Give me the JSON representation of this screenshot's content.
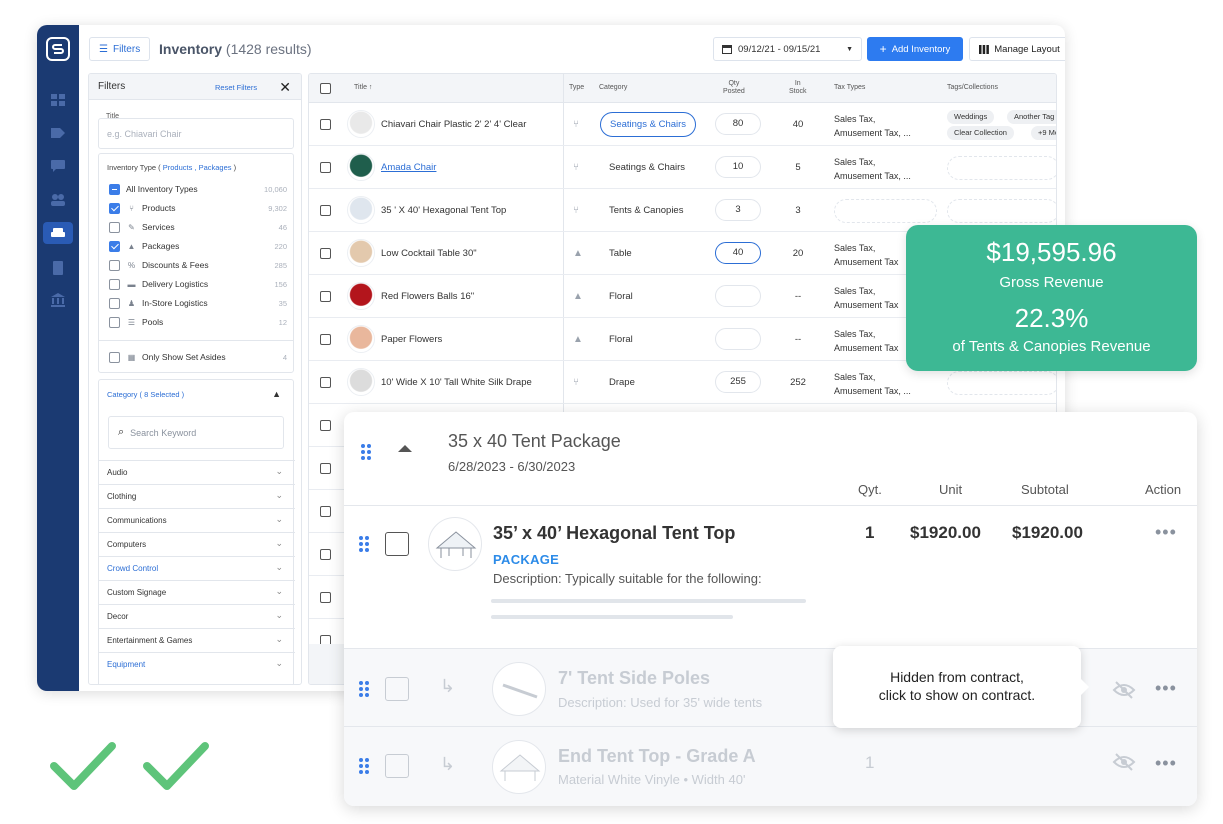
{
  "toolbar": {
    "filters_label": "Filters",
    "title": "Inventory",
    "results": "(1428 results)",
    "date_range": "09/12/21  -  09/15/21",
    "add_label": "Add Inventory",
    "layout_label": "Manage Layout"
  },
  "filters": {
    "heading": "Filters",
    "reset": "Reset Filters",
    "title_label": "Title",
    "title_placeholder": "e.g. Chiavari Chair",
    "type_label": "Inventory Type (",
    "type_selected": "Products , Packages",
    "type_close": ")",
    "types": [
      {
        "label": "All Inventory Types",
        "count": "10,060",
        "state": "ind",
        "icon": ""
      },
      {
        "label": "Products",
        "count": "9,302",
        "state": "on",
        "icon": "chair-icon"
      },
      {
        "label": "Services",
        "count": "46",
        "state": "off",
        "icon": "wrench-icon"
      },
      {
        "label": "Packages",
        "count": "220",
        "state": "on",
        "icon": "boxes-icon"
      },
      {
        "label": "Discounts & Fees",
        "count": "285",
        "state": "off",
        "icon": "tag-icon"
      },
      {
        "label": "Delivery Logistics",
        "count": "156",
        "state": "off",
        "icon": "truck-icon"
      },
      {
        "label": "In-Store Logistics",
        "count": "35",
        "state": "off",
        "icon": "person-icon"
      },
      {
        "label": "Pools",
        "count": "12",
        "state": "off",
        "icon": "list-icon"
      }
    ],
    "set_asides": {
      "label": "Only Show Set Asides",
      "count": "4"
    },
    "category_label": "Category (",
    "category_selected": "8 Selected",
    "category_close": ")",
    "keyword_placeholder": "Search Keyword",
    "categories": [
      {
        "label": "Audio",
        "blue": false
      },
      {
        "label": "Clothing",
        "blue": false
      },
      {
        "label": "Communications",
        "blue": false
      },
      {
        "label": "Computers",
        "blue": false
      },
      {
        "label": "Crowd Control",
        "blue": true
      },
      {
        "label": "Custom Signage",
        "blue": false
      },
      {
        "label": "Decor",
        "blue": false
      },
      {
        "label": "Entertainment & Games",
        "blue": false
      },
      {
        "label": "Equipment",
        "blue": true
      }
    ]
  },
  "table": {
    "headers": {
      "title": "Title ↑",
      "type": "Type",
      "category": "Category",
      "qty": [
        "Qty",
        "Posted"
      ],
      "stock": [
        "In",
        "Stock"
      ],
      "tax": "Tax Types",
      "tags": "Tags/Collections"
    },
    "rows": [
      {
        "title": "Chiavari Chair Plastic 2' 2' 4' Clear",
        "category": "Seatings & Chairs",
        "pill": true,
        "qty": "80",
        "hl": false,
        "stock": "40",
        "tax": [
          "Sales Tax,",
          "Amusement Tax, ..."
        ],
        "tags": [
          "Weddings",
          "Another Tag",
          "Clear Collection",
          "+9 More"
        ],
        "thumb": "#e9e9e9",
        "link": false
      },
      {
        "title": "Amada Chair",
        "category": "Seatings & Chairs",
        "pill": false,
        "qty": "10",
        "hl": false,
        "stock": "5",
        "tax": [
          "Sales Tax,",
          "Amusement Tax, ..."
        ],
        "tags": [],
        "thumb": "#1f5e4c",
        "link": true
      },
      {
        "title": "35 ' X 40' Hexagonal Tent Top",
        "category": "Tents & Canopies",
        "pill": false,
        "qty": "3",
        "hl": false,
        "stock": "3",
        "tax": [],
        "tags": [],
        "thumb": "#dfe6ee",
        "link": false
      },
      {
        "title": "Low Cocktail Table 30\"",
        "category": "Table",
        "pill": false,
        "qty": "40",
        "hl": true,
        "stock": "20",
        "tax": [
          "Sales Tax,",
          "Amusement Tax"
        ],
        "tags": [],
        "thumb": "#e3c9ad",
        "link": false
      },
      {
        "title": "Red Flowers Balls 16\"",
        "category": "Floral",
        "pill": false,
        "qty": "",
        "hl": false,
        "stock": "--",
        "tax": [
          "Sales Tax,",
          "Amusement Tax"
        ],
        "tags": [],
        "thumb": "#b3151c",
        "link": false
      },
      {
        "title": "Paper Flowers",
        "category": "Floral",
        "pill": false,
        "qty": "",
        "hl": false,
        "stock": "--",
        "tax": [
          "Sales Tax,",
          "Amusement Tax"
        ],
        "tags": [],
        "thumb": "#e9b79c",
        "link": false
      },
      {
        "title": "10' Wide X 10' Tall White Silk Drape",
        "category": "Drape",
        "pill": false,
        "qty": "255",
        "hl": false,
        "stock": "252",
        "tax": [
          "Sales Tax,",
          "Amusement Tax, ..."
        ],
        "tags": [],
        "thumb": "#dcdcdc",
        "link": false
      }
    ]
  },
  "revenue": {
    "gross_value": "$19,595.96",
    "gross_label": "Gross Revenue",
    "pct_value": "22.3%",
    "pct_label": "of Tents & Canopies Revenue"
  },
  "package": {
    "title": "35 x 40 Tent Package",
    "dates": "6/28/2023 - 6/30/2023",
    "col_qty": "Qyt.",
    "col_unit": "Unit",
    "col_subtotal": "Subtotal",
    "col_action": "Action",
    "item": {
      "title": "35’ x 40’ Hexagonal Tent Top",
      "kind": "PACKAGE",
      "desc": "Description: Typically suitable for the following:",
      "qty": "1",
      "unit": "$1920.00",
      "subtotal": "$1920.00"
    },
    "sub1": {
      "title": "7' Tent Side Poles",
      "desc": "Description: Used for 35' wide tents"
    },
    "sub2": {
      "title": "End Tent Top - Grade A",
      "desc": "Material White Vinyle • Width 40'",
      "qty": "1"
    }
  },
  "tooltip": {
    "line1": "Hidden from contract,",
    "line2": "click to show on contract."
  },
  "colors": {
    "rail": "#1b3a72",
    "accent": "#2d7bf0",
    "green": "#3db894",
    "check": "#5ec47a"
  }
}
